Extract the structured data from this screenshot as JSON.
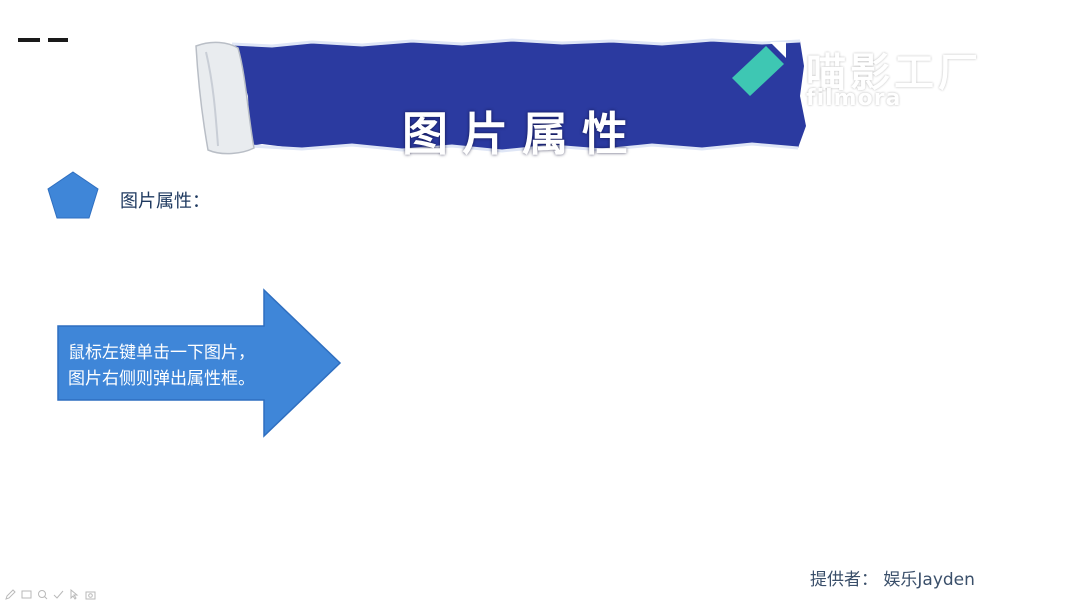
{
  "slide": {
    "banner_title": "图片属性",
    "bullet_label": "图片属性：",
    "arrow_text_lines": [
      "鼠标左键单击一下图片，",
      "图片右侧则弹出属性框。"
    ],
    "credit": "提供者：  娱乐Jayden"
  },
  "watermark": {
    "name": "喵影工厂",
    "sub": "filmora",
    "icon": "filmora-logo-icon"
  },
  "colors": {
    "banner_blue": "#2b3aa0",
    "shape_blue": "#3f86d8",
    "logo_teal": "#3ec7b3",
    "credit_text": "#3a4f6a"
  },
  "toolbar": {
    "icons": [
      "pen-icon",
      "slides-icon",
      "zoom-icon",
      "check-icon",
      "pointer-icon",
      "camera-icon"
    ]
  }
}
